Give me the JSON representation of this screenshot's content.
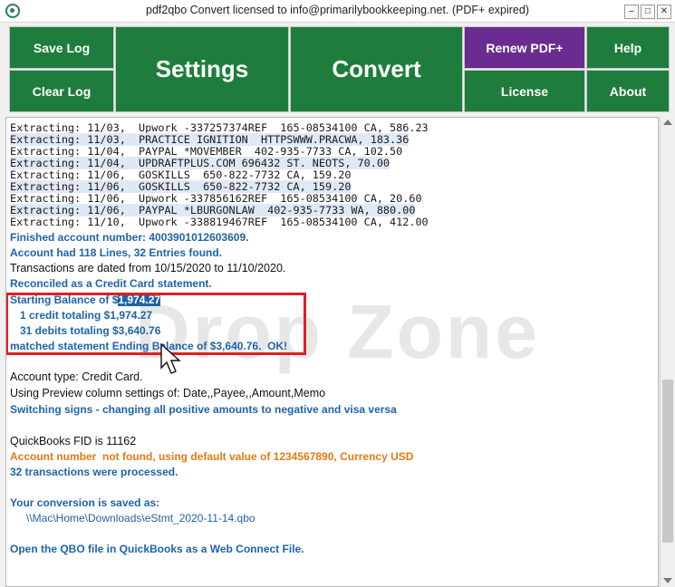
{
  "window": {
    "title": "pdf2qbo Convert licensed to info@primarilybookkeeping.net. (PDF+ expired)"
  },
  "toolbar": {
    "save_log": "Save Log",
    "clear_log": "Clear Log",
    "settings": "Settings",
    "convert": "Convert",
    "renew": "Renew PDF+",
    "help": "Help",
    "license": "License",
    "about": "About"
  },
  "colors": {
    "button_green": "#1e7d3c",
    "button_purple": "#6a2c91",
    "info_blue": "#1f63a8",
    "warn_orange": "#e27a13",
    "highlight_red": "#e02020"
  },
  "log": {
    "extract_lines": [
      "Extracting: 11/03,  Upwork -337257374REF  165-08534100 CA, 586.23",
      "Extracting: 11/03,  PRACTICE IGNITION  HTTPSWWW.PRACWA, 183.36",
      "Extracting: 11/04,  PAYPAL *MOVEMBER  402-935-7733 CA, 102.50",
      "Extracting: 11/04,  UPDRAFTPLUS.COM 696432 ST. NEOTS, 70.00",
      "Extracting: 11/06,  GOSKILLS  650-822-7732 CA, 159.20",
      "Extracting: 11/06,  GOSKILLS  650-822-7732 CA, 159.20",
      "Extracting: 11/06,  Upwork -337856162REF  165-08534100 CA, 20.60",
      "Extracting: 11/06,  PAYPAL *LBURGONLAW  402-935-7733 WA, 880.00",
      "Extracting: 11/10,  Upwork -338819467REF  165-08534100 CA, 412.00"
    ],
    "finished_account": "Finished account number: 4003901012603609.",
    "account_had": "Account had 118 Lines, 32 Entries found.",
    "dated": "Transactions are dated from 10/15/2020 to 11/10/2020.",
    "reconciled": "Reconciled as a Credit Card statement.",
    "starting_prefix": "Starting Balance of $",
    "starting_amount": "1,974.27",
    "credit_line": "1 credit totaling $1,974.27",
    "debits_line": "31 debits totaling $3,640.76",
    "matched_line": "matched statement Ending Balance of $3,640.76.  OK!",
    "account_type": "Account type: Credit Card.",
    "preview_settings": "Using Preview column settings of: Date,,Payee,,Amount,Memo",
    "switching_signs": "Switching signs - changing all positive amounts to negative and visa versa",
    "fid": "QuickBooks FID is 11162",
    "account_not_found": "Account number  not found, using default value of 1234567890, Currency USD",
    "processed": "32 transactions were processed.",
    "saved_as": "Your conversion is saved as:",
    "saved_path": "\\\\Mac\\Home\\Downloads\\eStmt_2020-11-14.qbo",
    "open_qbo": "Open the QBO file in QuickBooks as a Web Connect File."
  },
  "drop_zone": "Drop Zone"
}
